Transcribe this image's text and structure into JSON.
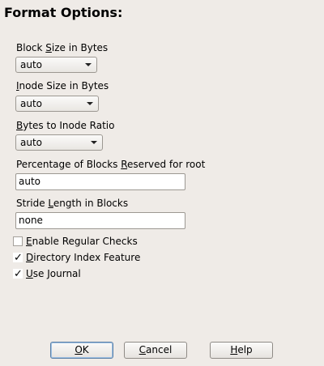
{
  "dialog": {
    "title": "Format Options:"
  },
  "block_size": {
    "label_pre": "Block ",
    "label_key": "S",
    "label_post": "ize in Bytes",
    "value": "auto"
  },
  "inode_size": {
    "label_pre": "",
    "label_key": "I",
    "label_post": "node Size in Bytes",
    "value": "auto"
  },
  "bytes_ratio": {
    "label_pre": "",
    "label_key": "B",
    "label_post": "ytes to Inode Ratio",
    "value": "auto"
  },
  "reserved": {
    "label_pre": "Percentage of Blocks ",
    "label_key": "R",
    "label_post": "eserved for root",
    "value": "auto"
  },
  "stride": {
    "label_pre": "Stride ",
    "label_key": "L",
    "label_post": "ength in Blocks",
    "value": "none"
  },
  "checks": {
    "regular_checks": {
      "label_key": "E",
      "label_post": "nable Regular Checks",
      "checked": false,
      "mark": ""
    },
    "dir_index": {
      "label_key": "D",
      "label_post": "irectory Index Feature",
      "checked": true,
      "mark": "✓"
    },
    "use_journal": {
      "label_key": "U",
      "label_post": "se Journal",
      "checked": true,
      "mark": "✓"
    }
  },
  "buttons": {
    "ok_key": "O",
    "ok_post": "K",
    "cancel_key": "C",
    "cancel_post": "ancel",
    "help_key": "H",
    "help_post": "elp"
  }
}
